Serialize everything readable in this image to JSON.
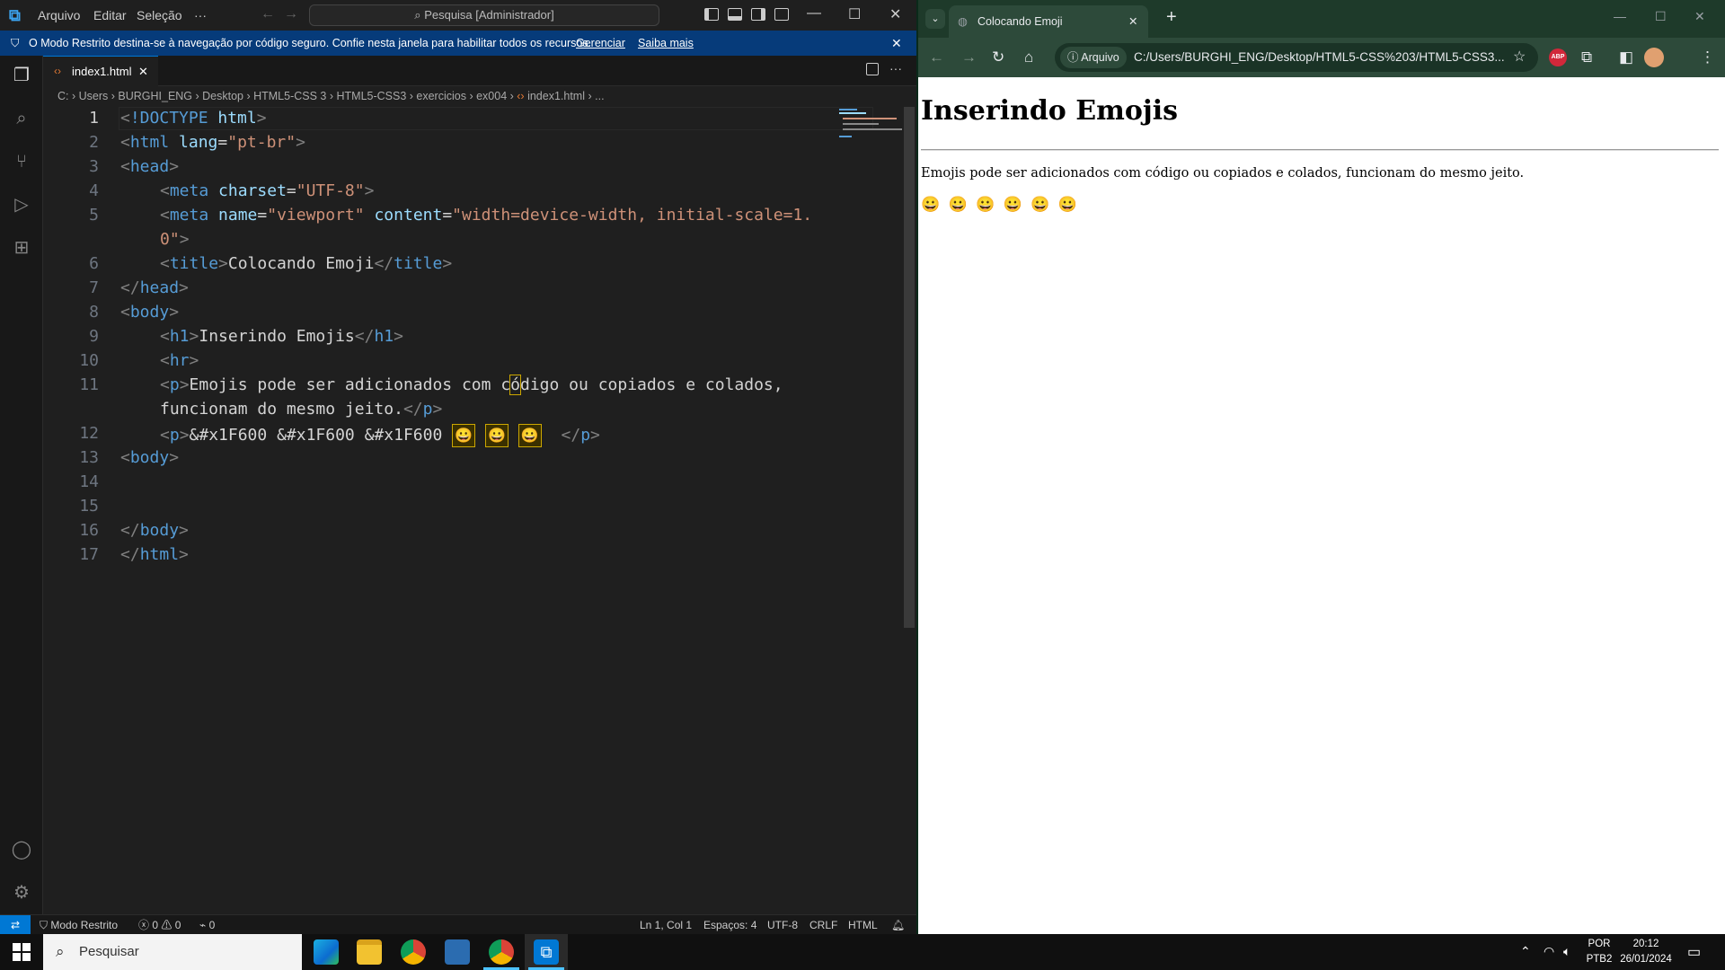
{
  "vscode": {
    "menu": [
      "Arquivo",
      "Editar",
      "Seleção",
      "···"
    ],
    "search_placeholder": "Pesquisa [Administrador]",
    "banner": {
      "text": "O Modo Restrito destina-se à navegação por código seguro. Confie nesta janela para habilitar todos os recursos.",
      "link_manage": "Gerenciar",
      "link_learn": "Saiba mais"
    },
    "tab_label": "index1.html",
    "breadcrumb": [
      "C:",
      "Users",
      "BURGHI_ENG",
      "Desktop",
      "HTML5-CSS 3",
      "HTML5-CSS3",
      "exercicios",
      "ex004",
      "index1.html",
      "..."
    ],
    "line_numbers": [
      "1",
      "2",
      "3",
      "4",
      "5",
      "",
      "6",
      "7",
      "8",
      "9",
      "10",
      "11",
      "",
      "12",
      "13",
      "14",
      "15",
      "16",
      "17"
    ],
    "code": {
      "l1a": "<",
      "l1b": "!DOCTYPE",
      "l1c": " html",
      "l1d": ">",
      "l2_tag": "html",
      "l2_attr": "lang",
      "l2_val": "\"pt-br\"",
      "l3_tag": "head",
      "l4_tag": "meta",
      "l4_attr": "charset",
      "l4_val": "\"UTF-8\"",
      "l5_tag": "meta",
      "l5_attr1": "name",
      "l5_val1": "\"viewport\"",
      "l5_attr2": "content",
      "l5_val2a": "\"width=device-width, initial-scale=1.",
      "l5_val2b": "0\"",
      "l6_tag": "title",
      "l6_text": "Colocando Emoji",
      "l7_tag": "head",
      "l8_tag": "body",
      "l9_tag": "h1",
      "l9_text": "Inserindo Emojis",
      "l10_tag": "hr",
      "l11_tag": "p",
      "l11_text_a": "Emojis pode ser adicionados com c",
      "l11_text_b": "ó",
      "l11_text_c": "digo ou copiados e colados,",
      "l11_text_d": "funcionam do mesmo jeito.",
      "l12_tag": "p",
      "l12_text": "&#x1F600 &#x1F600 &#x1F600",
      "emoji": "😀",
      "l13_tag": "body",
      "l16_tag": "body",
      "l17_tag": "html"
    },
    "status": {
      "remote": "⇄",
      "mode": "Modo Restrito",
      "errors": "0",
      "warnings": "0",
      "ports": "0",
      "cursor": "Ln 1, Col 1",
      "spaces": "Espaços: 4",
      "encoding": "UTF-8",
      "eol": "CRLF",
      "language": "HTML"
    }
  },
  "chrome": {
    "tab_title": "Colocando Emoji",
    "site_info": "Arquivo",
    "url": "C:/Users/BURGHI_ENG/Desktop/HTML5-CSS%203/HTML5-CSS3...",
    "abp": "ABP",
    "page": {
      "h1": "Inserindo Emojis",
      "paragraph": "Emojis pode ser adicionados com código ou copiados e colados, funcionam do mesmo jeito.",
      "emojis": "😀 😀 😀 😀 😀 😀"
    }
  },
  "taskbar": {
    "search_placeholder": "Pesquisar",
    "lang_top": "POR",
    "lang_bottom": "PTB2",
    "time": "20:12",
    "date": "26/01/2024"
  },
  "colors": {
    "vscode_bg": "#1f1f1f",
    "banner_bg": "#063b7a",
    "accent": "#0078d4",
    "chrome_frame": "#2d4a3a"
  }
}
